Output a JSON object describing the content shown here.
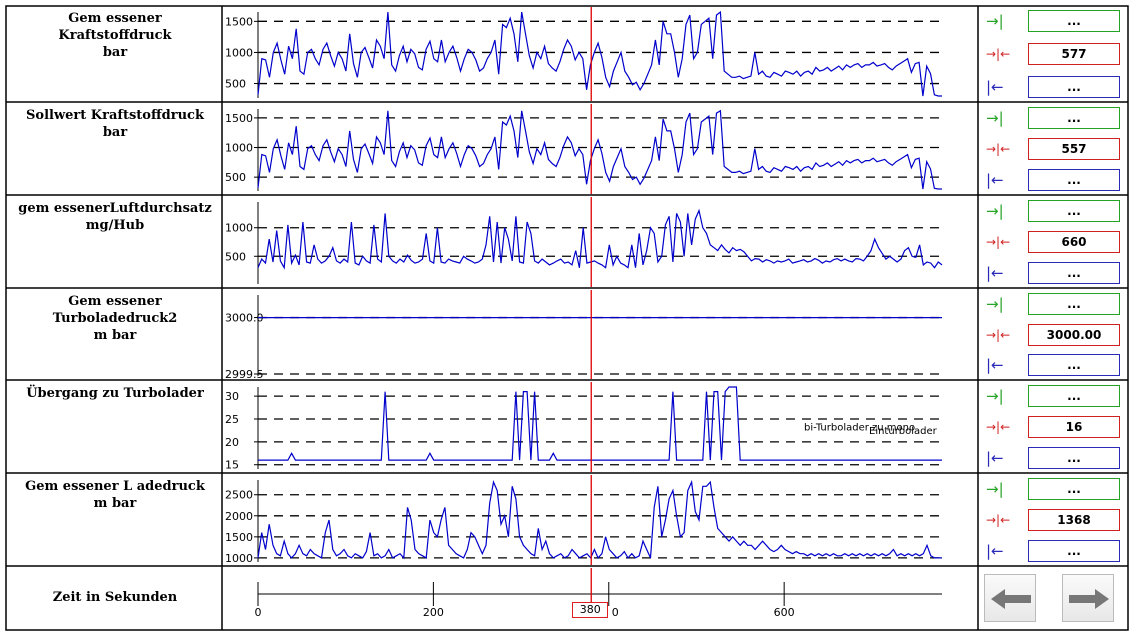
{
  "panels": [
    {
      "label_lines": [
        "Gem essener",
        "Kraftstoffdruck",
        "bar"
      ],
      "ticks": [
        "1500",
        "1000",
        "500"
      ],
      "tick_values": [
        1500,
        1000,
        500
      ],
      "ylim": [
        300,
        1650
      ],
      "value": "577",
      "top_button": "...",
      "bottom_button": "...",
      "series": [
        320,
        900,
        880,
        600,
        1000,
        1150,
        880,
        650,
        1100,
        900,
        1380,
        700,
        650,
        1000,
        1050,
        900,
        800,
        1050,
        1150,
        950,
        780,
        1000,
        900,
        700,
        1300,
        820,
        600,
        1000,
        1080,
        920,
        750,
        1200,
        1100,
        900,
        1650,
        800,
        700,
        950,
        1100,
        850,
        1050,
        980,
        760,
        720,
        1050,
        1180,
        900,
        850,
        1200,
        850,
        1000,
        1100,
        920,
        700,
        900,
        1050,
        1000,
        880,
        700,
        750,
        900,
        1000,
        1200,
        650,
        1450,
        1400,
        1550,
        1300,
        850,
        1650,
        1300,
        950,
        750,
        1000,
        900,
        1100,
        820,
        750,
        700,
        850,
        1050,
        1200,
        1100,
        880,
        1000,
        900,
        400,
        800,
        1000,
        1150,
        920,
        600,
        450,
        700,
        850,
        1000,
        700,
        600,
        480,
        520,
        400,
        500,
        650,
        800,
        1200,
        800,
        1500,
        1300,
        1300,
        1000,
        600,
        900,
        1450,
        1600,
        900,
        1000,
        1450,
        1500,
        1550,
        900,
        1600,
        1650,
        700,
        650,
        600,
        600,
        620,
        580,
        600,
        620,
        1000,
        650,
        700,
        620,
        600,
        680,
        650,
        620,
        700,
        680,
        650,
        700,
        620,
        680,
        700,
        650,
        760,
        700,
        720,
        760,
        700,
        740,
        780,
        720,
        800,
        760,
        800,
        820,
        760,
        800,
        800,
        840,
        780,
        800,
        820,
        760,
        720,
        780,
        820,
        860,
        900,
        680,
        820,
        840,
        300,
        780,
        660,
        320,
        300,
        300
      ]
    },
    {
      "label_lines": [
        "Sollwert Kraftstoffdruck",
        "bar"
      ],
      "ticks": [
        "1500",
        "1000",
        "500"
      ],
      "tick_values": [
        1500,
        1000,
        500
      ],
      "ylim": [
        300,
        1650
      ],
      "value": "557",
      "top_button": "...",
      "bottom_button": "...",
      "series": [
        320,
        880,
        860,
        580,
        980,
        1130,
        860,
        630,
        1080,
        880,
        1360,
        680,
        630,
        980,
        1030,
        880,
        780,
        1030,
        1130,
        930,
        760,
        980,
        880,
        680,
        1280,
        800,
        580,
        980,
        1060,
        900,
        730,
        1180,
        1080,
        880,
        1620,
        780,
        680,
        930,
        1080,
        830,
        1030,
        960,
        740,
        700,
        1030,
        1160,
        880,
        830,
        1180,
        830,
        980,
        1080,
        900,
        680,
        880,
        1030,
        980,
        860,
        680,
        730,
        880,
        980,
        1180,
        630,
        1430,
        1380,
        1530,
        1280,
        830,
        1620,
        1280,
        930,
        730,
        980,
        880,
        1080,
        800,
        730,
        680,
        830,
        1030,
        1180,
        1080,
        860,
        980,
        880,
        380,
        780,
        980,
        1130,
        900,
        580,
        430,
        680,
        830,
        980,
        680,
        580,
        460,
        500,
        380,
        480,
        630,
        780,
        1180,
        780,
        1480,
        1280,
        1280,
        980,
        580,
        880,
        1430,
        1580,
        880,
        980,
        1430,
        1480,
        1530,
        880,
        1580,
        1620,
        680,
        630,
        580,
        580,
        600,
        560,
        580,
        600,
        980,
        630,
        680,
        600,
        580,
        660,
        630,
        600,
        680,
        660,
        630,
        680,
        600,
        660,
        680,
        630,
        740,
        680,
        700,
        740,
        680,
        720,
        760,
        700,
        780,
        740,
        780,
        800,
        740,
        780,
        780,
        820,
        760,
        780,
        800,
        740,
        700,
        760,
        800,
        840,
        880,
        660,
        800,
        820,
        300,
        760,
        640,
        310,
        300,
        300
      ]
    },
    {
      "label_lines": [
        "gem essenerLuftdurchsatz",
        "mg/Hub"
      ],
      "ticks": [
        "1000",
        "500"
      ],
      "tick_values": [
        1000,
        500
      ],
      "ylim": [
        50,
        1450
      ],
      "value": "660",
      "top_button": "...",
      "bottom_button": "...",
      "series": [
        300,
        450,
        380,
        800,
        400,
        950,
        420,
        300,
        1050,
        380,
        520,
        350,
        1100,
        400,
        380,
        700,
        450,
        380,
        420,
        500,
        650,
        420,
        380,
        450,
        400,
        1100,
        380,
        350,
        500,
        420,
        380,
        1050,
        450,
        400,
        1250,
        500,
        420,
        380,
        450,
        400,
        520,
        430,
        380,
        400,
        450,
        900,
        420,
        380,
        1000,
        400,
        380,
        450,
        420,
        400,
        380,
        500,
        450,
        420,
        380,
        400,
        450,
        700,
        1200,
        400,
        1100,
        380,
        1000,
        800,
        420,
        1200,
        400,
        380,
        1100,
        900,
        420,
        380,
        450,
        400,
        350,
        380,
        420,
        450,
        380,
        400,
        350,
        600,
        300,
        1000,
        380,
        400,
        420,
        380,
        350,
        300,
        700,
        350,
        500,
        380,
        350,
        300,
        700,
        300,
        900,
        350,
        600,
        1000,
        900,
        400,
        500,
        1050,
        1200,
        400,
        1250,
        1100,
        500,
        1250,
        700,
        1150,
        1300,
        1000,
        900,
        700,
        650,
        600,
        700,
        620,
        560,
        650,
        600,
        620,
        580,
        500,
        420,
        460,
        450,
        400,
        440,
        420,
        380,
        420,
        400,
        420,
        450,
        380,
        400,
        420,
        440,
        400,
        420,
        460,
        430,
        380,
        420,
        400,
        440,
        460,
        420,
        450,
        420,
        400,
        460,
        450,
        420,
        500,
        600,
        800,
        650,
        550,
        450,
        500,
        450,
        400,
        450,
        600,
        650,
        500,
        480,
        700,
        350,
        400,
        380,
        300,
        400,
        350
      ]
    },
    {
      "label_lines": [
        "Gem essener",
        "Turboladedruck2",
        "m bar"
      ],
      "ticks": [
        "3000.0",
        "2999.5"
      ],
      "tick_values": [
        3000.0,
        2999.5
      ],
      "ylim": [
        2999.5,
        3000.2
      ],
      "value": "3000.00",
      "top_button": "...",
      "bottom_button": "...",
      "series": [
        3000,
        3000
      ]
    },
    {
      "label_lines": [
        "Übergang zu Turbolader"
      ],
      "ticks": [
        "30",
        "25",
        "20",
        "15"
      ],
      "tick_values": [
        30,
        25,
        20,
        15
      ],
      "ylim": [
        14.5,
        32
      ],
      "value": "16",
      "annotation_1": "bi-Turbolader zu mono",
      "annotation_2": "Einturbolader",
      "top_button": "...",
      "bottom_button": "...",
      "series": [
        16,
        16,
        16,
        16,
        16,
        16,
        16,
        16,
        16,
        17.5,
        16,
        16,
        16,
        16,
        16,
        16,
        16,
        16,
        16,
        16,
        16,
        16,
        16,
        16,
        16,
        16,
        16,
        16,
        16,
        16,
        16,
        16,
        16,
        16,
        31,
        16,
        16,
        16,
        16,
        16,
        16,
        16,
        16,
        16,
        16,
        16,
        17.5,
        16,
        16,
        16,
        16,
        16,
        16,
        16,
        16,
        16,
        16,
        16,
        16,
        16,
        16,
        16,
        16,
        16,
        16,
        16,
        16,
        16,
        16,
        31,
        16,
        31,
        31,
        16,
        31,
        16,
        16,
        16,
        16,
        17.5,
        16,
        16,
        16,
        16,
        16,
        16,
        16,
        16,
        16,
        16,
        16,
        16,
        16,
        16,
        16,
        16,
        16,
        16,
        16,
        16,
        16,
        16,
        16,
        16,
        16,
        16,
        16,
        16,
        16,
        16,
        16,
        31,
        16,
        16,
        16,
        16,
        16,
        16,
        16,
        16,
        31,
        16,
        31,
        31,
        16,
        31,
        32,
        32,
        32,
        16,
        16,
        16,
        16,
        16,
        16,
        16,
        16,
        16,
        16,
        16,
        16,
        16,
        16,
        16,
        16,
        16,
        16,
        16,
        16,
        16,
        16,
        16,
        16,
        16,
        16,
        16,
        16,
        16,
        16,
        16,
        16,
        16,
        16,
        16,
        16,
        16,
        16,
        16,
        16,
        16,
        16,
        16,
        16,
        16,
        16,
        16,
        16,
        16,
        16,
        16,
        16,
        16,
        16,
        16
      ]
    },
    {
      "label_lines": [
        "Gem essener L adedruck",
        "m bar"
      ],
      "ticks": [
        "2500",
        "2000",
        "1500",
        "1000"
      ],
      "tick_values": [
        2500,
        2000,
        1500,
        1000
      ],
      "ylim": [
        950,
        2850
      ],
      "value": "1368",
      "top_button": "...",
      "bottom_button": "...",
      "series": [
        1000,
        1600,
        1200,
        1800,
        1300,
        1100,
        1050,
        1400,
        1100,
        1000,
        1100,
        1300,
        1100,
        1050,
        1200,
        1100,
        1050,
        1000,
        1600,
        1900,
        1200,
        1050,
        1100,
        1200,
        1050,
        1000,
        1100,
        1050,
        1000,
        1150,
        1600,
        1050,
        1100,
        1000,
        1050,
        1200,
        1000,
        1050,
        1100,
        1000,
        2200,
        1900,
        1200,
        1100,
        1050,
        1000,
        1900,
        1600,
        1500,
        1900,
        2200,
        1300,
        1200,
        1100,
        1050,
        1000,
        1200,
        1600,
        1500,
        1300,
        1100,
        1300,
        2300,
        2800,
        2600,
        1800,
        2000,
        1500,
        2700,
        2400,
        1500,
        1300,
        1200,
        1100,
        1050,
        1700,
        1200,
        1400,
        1100,
        1000,
        1050,
        1100,
        1000,
        1050,
        1200,
        1100,
        1000,
        1050,
        1100,
        1000,
        1200,
        1000,
        1100,
        1500,
        1200,
        1100,
        1000,
        1050,
        1150,
        1000,
        1100,
        1000,
        1050,
        1400,
        1200,
        1000,
        2200,
        2700,
        1500,
        1900,
        2400,
        2600,
        2000,
        1500,
        1600,
        2600,
        2800,
        2100,
        1900,
        2700,
        2700,
        2800,
        2200,
        1700,
        1600,
        1500,
        1400,
        1500,
        1400,
        1300,
        1400,
        1300,
        1300,
        1200,
        1300,
        1400,
        1300,
        1200,
        1150,
        1200,
        1300,
        1200,
        1150,
        1100,
        1150,
        1100,
        1100,
        1050,
        1100,
        1050,
        1100,
        1050,
        1100,
        1050,
        1100,
        1050,
        1050,
        1100,
        1050,
        1100,
        1050,
        1100,
        1050,
        1100,
        1050,
        1100,
        1050,
        1100,
        1050,
        1100,
        1200,
        1050,
        1100,
        1050,
        1100,
        1050,
        1100,
        1050,
        1100,
        1300,
        1050,
        1000,
        1000,
        1000
      ]
    }
  ],
  "time_axis": {
    "label": "Zeit in Sekunden",
    "ticks": [
      "0",
      "200",
      "600"
    ],
    "tick_values": [
      0,
      200,
      600
    ],
    "cursor_value": "380",
    "cursor_suffix": "0",
    "xlim": [
      0,
      780
    ],
    "cursor": 380
  },
  "colors": {
    "series": "#0000cc",
    "cursor": "#e00000",
    "grid": "#000000",
    "button_green": "#25a325",
    "button_red": "#d02020",
    "button_blue": "#2a2ab8"
  },
  "icons": [
    "jump-to-end-icon",
    "jump-to-cursor-icon",
    "jump-to-start-icon",
    "arrow-left-icon",
    "arrow-right-icon"
  ],
  "chart_data": [
    {
      "type": "line",
      "title": "Gem essener Kraftstoffdruck bar",
      "ylabel": "bar",
      "ylim": [
        300,
        1650
      ],
      "xlim": [
        0,
        780
      ],
      "grid": true
    },
    {
      "type": "line",
      "title": "Sollwert Kraftstoffdruck bar",
      "ylabel": "bar",
      "ylim": [
        300,
        1650
      ],
      "xlim": [
        0,
        780
      ],
      "grid": true
    },
    {
      "type": "line",
      "title": "gem essenerLuftdurchsatz mg/Hub",
      "ylabel": "mg/Hub",
      "ylim": [
        50,
        1450
      ],
      "xlim": [
        0,
        780
      ],
      "grid": true
    },
    {
      "type": "line",
      "title": "Gem essener Turboladedruck2 m bar",
      "ylabel": "m bar",
      "ylim": [
        2999.5,
        3000.2
      ],
      "xlim": [
        0,
        780
      ],
      "grid": true
    },
    {
      "type": "line",
      "title": "Übergang zu Turbolader",
      "ylim": [
        14.5,
        32
      ],
      "xlim": [
        0,
        780
      ],
      "grid": true
    },
    {
      "type": "line",
      "title": "Gem essener L adedruck m bar",
      "ylabel": "m bar",
      "ylim": [
        950,
        2850
      ],
      "xlim": [
        0,
        780
      ],
      "grid": true
    }
  ]
}
